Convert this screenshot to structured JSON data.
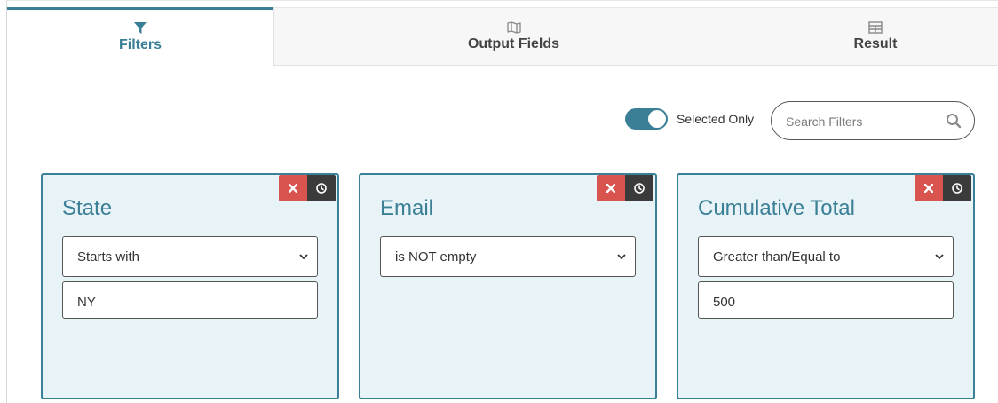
{
  "colors": {
    "accent": "#3a7f95",
    "danger": "#d9534f",
    "dark": "#3b3b3b",
    "card_bg": "#e8f3f8"
  },
  "tabs": [
    {
      "label": "Filters",
      "icon": "filter-icon",
      "active": true
    },
    {
      "label": "Output Fields",
      "icon": "map-icon",
      "active": false
    },
    {
      "label": "Result",
      "icon": "table-icon",
      "active": false
    }
  ],
  "toolbar": {
    "toggle_label": "Selected Only",
    "toggle_on": true,
    "search_placeholder": "Search Filters",
    "search_value": ""
  },
  "filters": [
    {
      "field": "State",
      "operator": "Starts with",
      "value": "NY"
    },
    {
      "field": "Email",
      "operator": "is NOT empty"
    },
    {
      "field": "Cumulative Total",
      "operator": "Greater than/Equal to",
      "value": "500"
    }
  ]
}
